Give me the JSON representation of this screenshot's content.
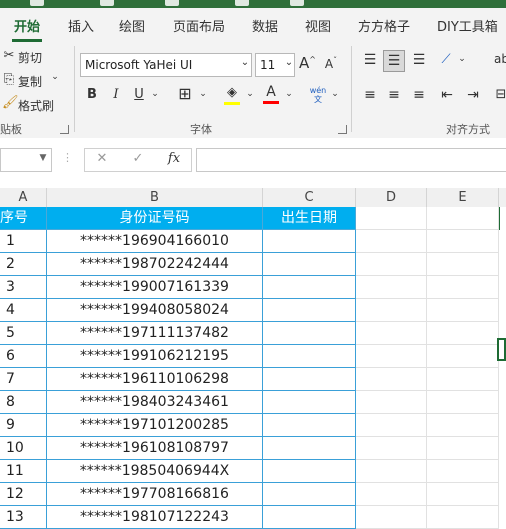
{
  "tabs": [
    "开始",
    "插入",
    "绘图",
    "页面布局",
    "数据",
    "视图",
    "方方格子",
    "DIY工具箱"
  ],
  "clipboard": {
    "cut": "剪切",
    "copy": "复制",
    "format_painter": "格式刷",
    "group_label": "贴板"
  },
  "font": {
    "name": "Microsoft YaHei UI",
    "size": "11",
    "group_label": "字体",
    "bold": "B",
    "italic": "I",
    "underline": "U",
    "grow": "A",
    "shrink": "A",
    "font_color_glyph": "A",
    "phonetic_glyph": "wén 文"
  },
  "alignment": {
    "group_label": "对齐方式"
  },
  "formula_bar": {
    "fx": "fx",
    "cancel": "✕",
    "enter": "✓",
    "value": ""
  },
  "columns": [
    "A",
    "B",
    "C",
    "D",
    "E"
  ],
  "table": {
    "headers": [
      "序号",
      "身份证号码",
      "出生日期"
    ],
    "rows": [
      {
        "no": "1",
        "id": "******196904166010"
      },
      {
        "no": "2",
        "id": "******198702242444"
      },
      {
        "no": "3",
        "id": "******199007161339"
      },
      {
        "no": "4",
        "id": "******199408058024"
      },
      {
        "no": "5",
        "id": "******197111137482"
      },
      {
        "no": "6",
        "id": "******199106212195"
      },
      {
        "no": "7",
        "id": "******196110106298"
      },
      {
        "no": "8",
        "id": "******198403243461"
      },
      {
        "no": "9",
        "id": "******197101200285"
      },
      {
        "no": "10",
        "id": "******196108108797"
      },
      {
        "no": "11",
        "id": "******19850406944X"
      },
      {
        "no": "12",
        "id": "******197708166816"
      },
      {
        "no": "13",
        "id": "******198107122243"
      }
    ]
  },
  "colors": {
    "accent": "#1e6b34",
    "header_fill": "#00aeef",
    "border": "#3aa0d8",
    "highlight_yellow": "#ffff00",
    "font_red": "#ff0000"
  }
}
